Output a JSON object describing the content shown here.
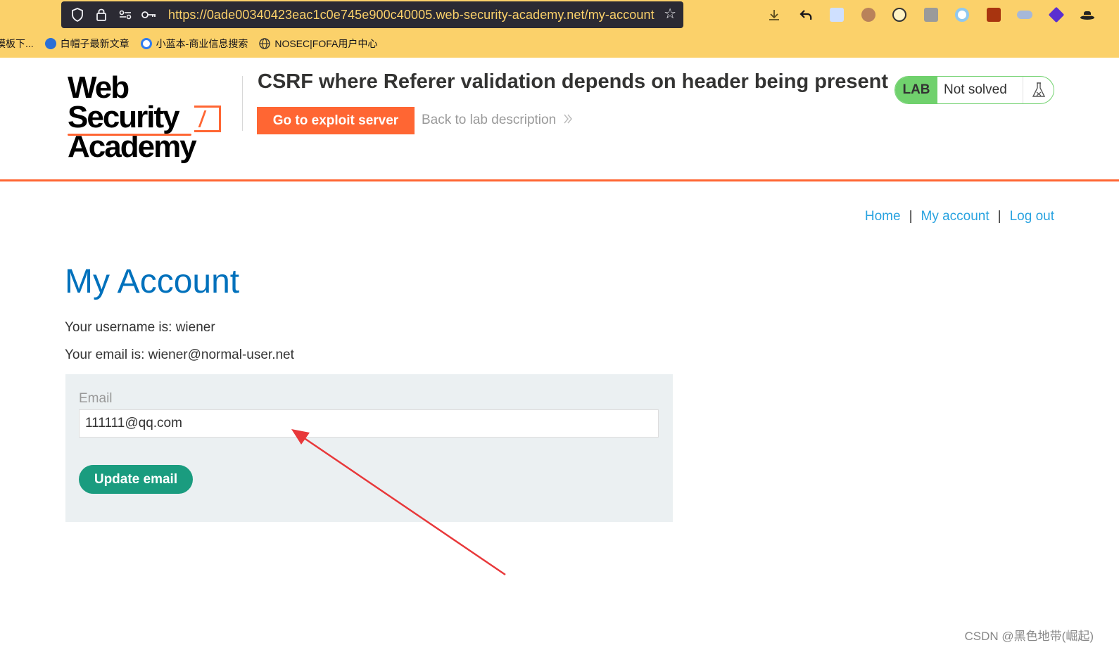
{
  "browser": {
    "url": "https://0ade00340423eac1c0e745e900c40005.web-security-academy.net/my-account",
    "bookmarks": [
      {
        "label": "模板下...",
        "color": "#d8a03a"
      },
      {
        "label": "白帽子最新文章",
        "color": "#2a6fd6"
      },
      {
        "label": "小蓝本-商业信息搜索",
        "color": "#2f7cf0"
      },
      {
        "label": "NOSEC|FOFA用户中心",
        "color": "#333333"
      }
    ]
  },
  "lab": {
    "logo_line1": "Web Security",
    "logo_line2": "Academy",
    "title": "CSRF where Referer validation depends on header being present",
    "exploit_button": "Go to exploit server",
    "back_link": "Back to lab description",
    "status_tag": "LAB",
    "status": "Not solved"
  },
  "nav": {
    "home": "Home",
    "my_account": "My account",
    "log_out": "Log out",
    "separator": "|"
  },
  "account": {
    "title": "My Account",
    "username_line": "Your username is: wiener",
    "email_line": "Your email is: wiener@normal-user.net",
    "email_label": "Email",
    "email_value": "111111@qq.com",
    "update_button": "Update email"
  },
  "watermark": "CSDN @黑色地带(崛起)",
  "colors": {
    "accent_orange": "#ff6633",
    "link_blue": "#29a3e0",
    "title_blue": "#0071bc",
    "button_green": "#1a9c7f",
    "lab_green": "#70d16d"
  }
}
